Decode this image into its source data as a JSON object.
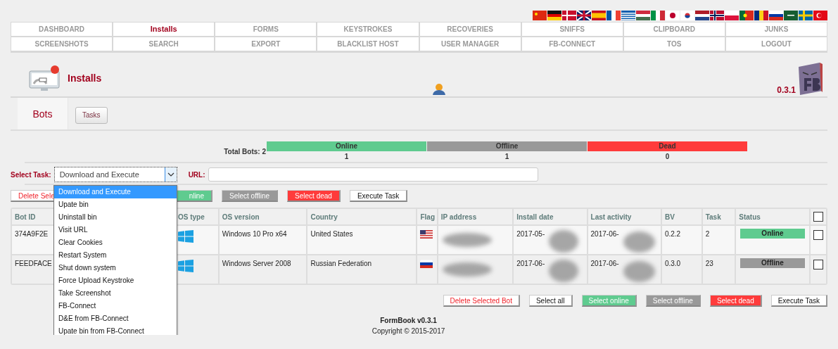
{
  "nav": [
    {
      "label": "DASHBOARD",
      "selected": false
    },
    {
      "label": "Installs",
      "selected": true
    },
    {
      "label": "FORMS",
      "selected": false
    },
    {
      "label": "KEYSTROKES",
      "selected": false
    },
    {
      "label": "RECOVERIES",
      "selected": false
    },
    {
      "label": "SNIFFS",
      "selected": false
    },
    {
      "label": "CLIPBOARD",
      "selected": false
    },
    {
      "label": "JUNKS",
      "selected": false
    },
    {
      "label": "SCREENSHOTS",
      "selected": false
    },
    {
      "label": "SEARCH",
      "selected": false
    },
    {
      "label": "EXPORT",
      "selected": false
    },
    {
      "label": "BLACKLIST HOST",
      "selected": false
    },
    {
      "label": "USER MANAGER",
      "selected": false
    },
    {
      "label": "FB-CONNECT",
      "selected": false
    },
    {
      "label": "TOS",
      "selected": false
    },
    {
      "label": "LOGOUT",
      "selected": false
    }
  ],
  "header": {
    "title": "Installs",
    "version": "0.3.1"
  },
  "tabs": [
    {
      "label": "Bots",
      "selected": true
    },
    {
      "label": "Tasks",
      "selected": false
    }
  ],
  "stats": {
    "total": "Total Bots: 2",
    "bars": [
      {
        "label": "Online",
        "count": "1",
        "color": "#5fcb8f"
      },
      {
        "label": "Offline",
        "count": "1",
        "color": "#999999"
      },
      {
        "label": "Dead",
        "count": "0",
        "color": "#ff3b3b"
      }
    ]
  },
  "task": {
    "label": "Select Task:",
    "value": "Download and Execute",
    "url_label": "URL:",
    "options": [
      {
        "label": "Download and Execute",
        "selected": true
      },
      {
        "label": "Upate bin",
        "selected": false
      },
      {
        "label": "Uninstall bin",
        "selected": false
      },
      {
        "label": "Visit URL",
        "selected": false
      },
      {
        "label": "Clear Cookies",
        "selected": false
      },
      {
        "label": "Restart System",
        "selected": false
      },
      {
        "label": "Shut down system",
        "selected": false
      },
      {
        "label": "Force Upload Keystroke",
        "selected": false
      },
      {
        "label": "Take Screenshot",
        "selected": false
      },
      {
        "label": "FB-Connect",
        "selected": false
      },
      {
        "label": "D&E from FB-Connect",
        "selected": false
      },
      {
        "label": "Upate bin from FB-Connect",
        "selected": false
      }
    ]
  },
  "top_buttons": [
    {
      "label": "Delete Sele",
      "kind": "delete"
    },
    {
      "label": "nline",
      "kind": "online"
    },
    {
      "label": "Select offline",
      "kind": "offline"
    },
    {
      "label": "Select dead",
      "kind": "dead"
    },
    {
      "label": "Execute Task",
      "kind": "plain"
    }
  ],
  "table": {
    "columns": [
      "Bot ID",
      "OS type",
      "OS version",
      "Country",
      "Flag",
      "IP address",
      "Install date",
      "Last activity",
      "BV",
      "Task",
      "Status"
    ],
    "select_all_checked": false,
    "rows": [
      {
        "bot_id": "374A9F2E",
        "os_version": "Windows 10 Pro x64",
        "country": "United States",
        "kind": "us",
        "install_date": "2017-05-",
        "last_activity": "2017-06-",
        "bv": "0.2.2",
        "task": "2",
        "status": {
          "label": "Online",
          "color": "#5fcb8f"
        },
        "checked": false
      },
      {
        "bot_id": "FEEDFACE",
        "os_version": "Windows Server 2008",
        "country": "Russian Federation",
        "kind": "ru",
        "install_date": "2017-06-",
        "last_activity": "2017-06-",
        "bv": "0.3.0",
        "task": "23",
        "status": {
          "label": "Offline",
          "color": "#999999"
        },
        "checked": false
      }
    ]
  },
  "bottom_buttons": [
    {
      "label": "Delete Selected Bot",
      "kind": "delete"
    },
    {
      "label": "Select all",
      "kind": "plain"
    },
    {
      "label": "Select online",
      "kind": "online"
    },
    {
      "label": "Select offline",
      "kind": "offline"
    },
    {
      "label": "Select dead",
      "kind": "dead"
    },
    {
      "label": "Execute Task",
      "kind": "plain"
    }
  ],
  "footer": {
    "title": "FormBook v0.3.1",
    "copyright": "Copyright © 2015-2017"
  }
}
